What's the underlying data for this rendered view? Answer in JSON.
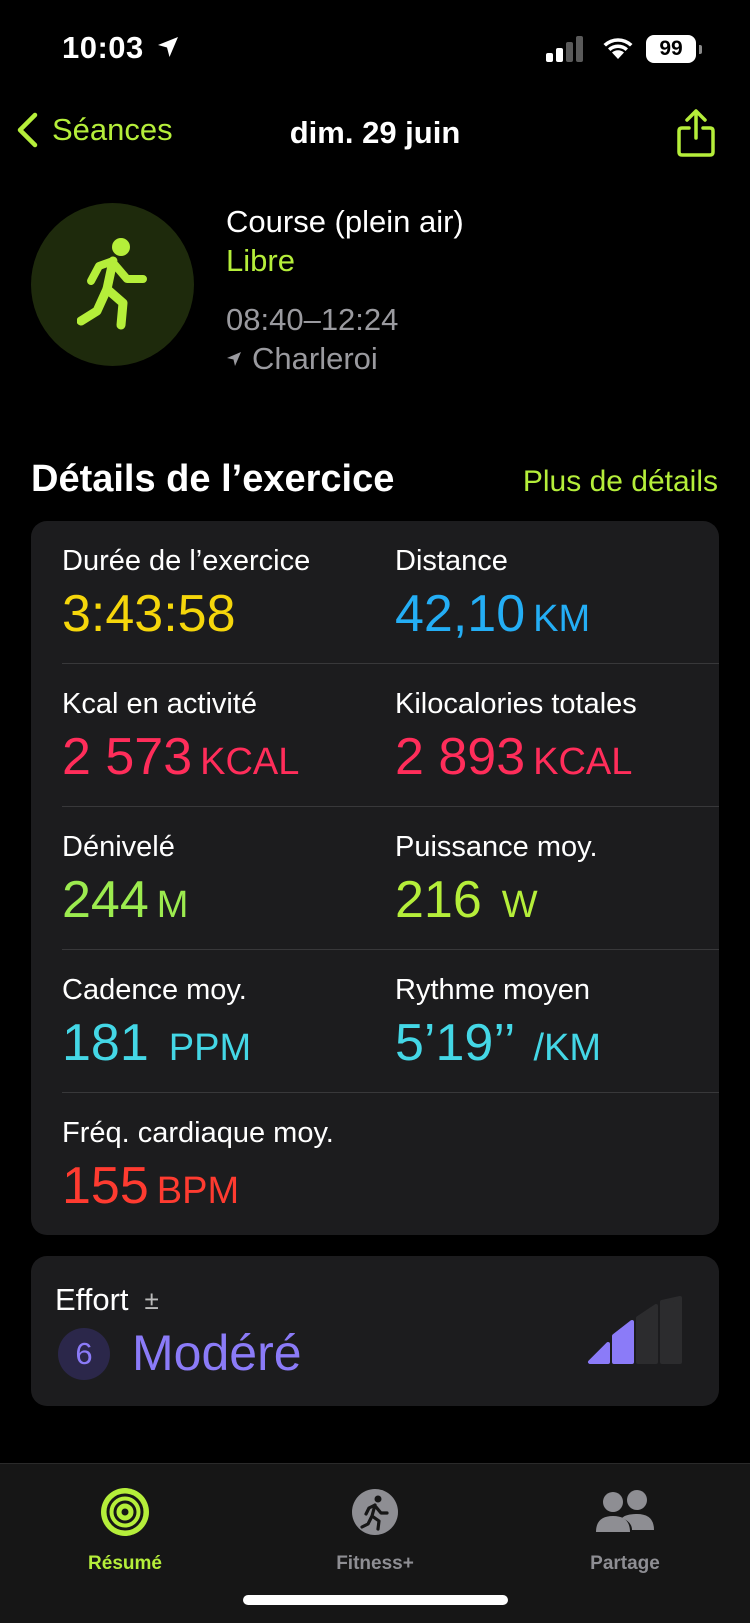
{
  "status": {
    "time": "10:03",
    "battery": "99"
  },
  "nav": {
    "back_label": "Séances",
    "title": "dim. 29 juin"
  },
  "workout": {
    "type": "Course (plein air)",
    "goal": "Libre",
    "time_range": "08:40–12:24",
    "location": "Charleroi"
  },
  "section": {
    "title": "Détails de l’exercice",
    "more": "Plus de détails"
  },
  "metrics": {
    "duration": {
      "label": "Durée de l’exercice",
      "value": "3:43:58",
      "color": "#f5d60b"
    },
    "distance": {
      "label": "Distance",
      "value": "42,10",
      "unit": "KM",
      "color": "#24aef5"
    },
    "active_kcal": {
      "label": "Kcal en activité",
      "value": "2 573",
      "unit": "KCAL",
      "color": "#ff2d5a"
    },
    "total_kcal": {
      "label": "Kilocalories totales",
      "value": "2 893",
      "unit": "KCAL",
      "color": "#ff2d5a"
    },
    "elevation": {
      "label": "Dénivelé",
      "value": "244",
      "unit": "M",
      "color": "#9ceb4f"
    },
    "power": {
      "label": "Puissance moy.",
      "value": "216",
      "unit": "W",
      "color": "#b5ee3a"
    },
    "cadence": {
      "label": "Cadence moy.",
      "value": "181",
      "unit": "PPM",
      "color": "#44d7e6"
    },
    "pace": {
      "label": "Rythme moyen",
      "value": "5’19’’",
      "unit": "/KM",
      "color": "#44d7e6"
    },
    "heart_rate": {
      "label": "Fréq. cardiaque moy.",
      "value": "155",
      "unit": "BPM",
      "color": "#ff3b30"
    }
  },
  "effort": {
    "label": "Effort",
    "plus_minus": "±",
    "score": "6",
    "level_text": "Modéré",
    "level_filled_bars": 2,
    "level_total_bars": 4
  },
  "tabs": [
    {
      "label": "Résumé",
      "icon": "activity-rings-icon",
      "active": true
    },
    {
      "label": "Fitness+",
      "icon": "fitness-plus-icon",
      "active": false
    },
    {
      "label": "Partage",
      "icon": "people-icon",
      "active": false
    }
  ],
  "colors": {
    "accent": "#b5ee3a",
    "effort": "#8b7bf8",
    "card": "#1c1c1e"
  }
}
